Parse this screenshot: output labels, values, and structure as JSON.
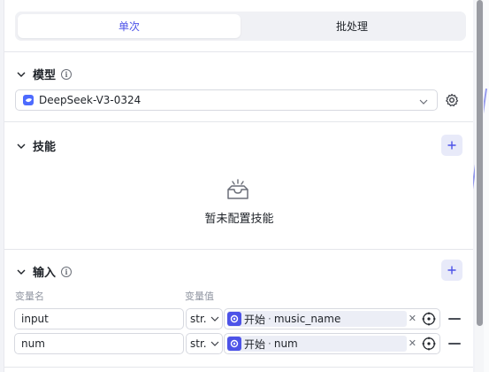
{
  "tabs": [
    {
      "label": "单次",
      "active": true
    },
    {
      "label": "批处理",
      "active": false
    }
  ],
  "model": {
    "section_title": "模型",
    "selected": "DeepSeek-V3-0324"
  },
  "skills": {
    "section_title": "技能",
    "empty_text": "暂未配置技能"
  },
  "inputs": {
    "section_title": "输入",
    "col_name": "变量名",
    "col_value": "变量值",
    "rows": [
      {
        "name": "input",
        "type": "str.",
        "ref_node": "开始",
        "ref_var": "music_name"
      },
      {
        "name": "num",
        "type": "str.",
        "ref_node": "开始",
        "ref_var": "num"
      }
    ]
  },
  "colors": {
    "accent": "#4d53e8",
    "model_logo": "#4d6bfe"
  }
}
